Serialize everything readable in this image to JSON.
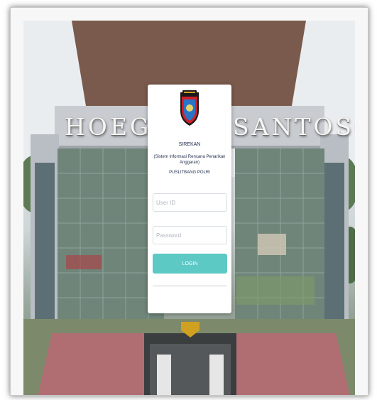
{
  "building": {
    "sign_left": "HOEGENG",
    "sign_right": "SANTOSO"
  },
  "login": {
    "app_name": "SIREKAN",
    "app_description": "(Sistem Informasi Rencana Penarikan Anggaran)",
    "organization": "PUSLITBANG POLRI",
    "userid_placeholder": "User ID",
    "password_placeholder": "Password",
    "login_label": "LOGIN"
  },
  "colors": {
    "accent": "#5cc9c5",
    "text": "#1e2a4a",
    "logo_red": "#d0202a",
    "logo_blue": "#2a74c8"
  },
  "icons": {
    "logo": "police-emblem-icon"
  }
}
